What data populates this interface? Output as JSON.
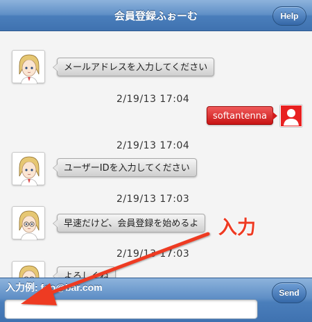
{
  "header": {
    "title": "会員登録ふぉーむ",
    "help_label": "Help"
  },
  "messages": [
    {
      "from": "bot",
      "text": "メールアドレスを入力してください"
    },
    {
      "timestamp": "2/19/13 17:04"
    },
    {
      "from": "user",
      "text": "softantenna"
    },
    {
      "timestamp": "2/19/13 17:04"
    },
    {
      "from": "bot",
      "text": "ユーザーIDを入力してください"
    },
    {
      "timestamp": "2/19/13 17:03"
    },
    {
      "from": "bot",
      "text": "早速だけど、会員登録を始めるよ"
    },
    {
      "timestamp": "2/19/13 17:03"
    },
    {
      "from": "bot",
      "text": "よろしくね"
    }
  ],
  "footer": {
    "input_label": "入力例: foo@bar.com",
    "input_value": "",
    "send_label": "Send"
  },
  "annotation": {
    "label": "入力",
    "color": "#ee3a22"
  },
  "colors": {
    "header_blue": "#4a7ebb",
    "user_bubble_red": "#c81414",
    "bot_bubble_gray": "#e0e0e0"
  }
}
